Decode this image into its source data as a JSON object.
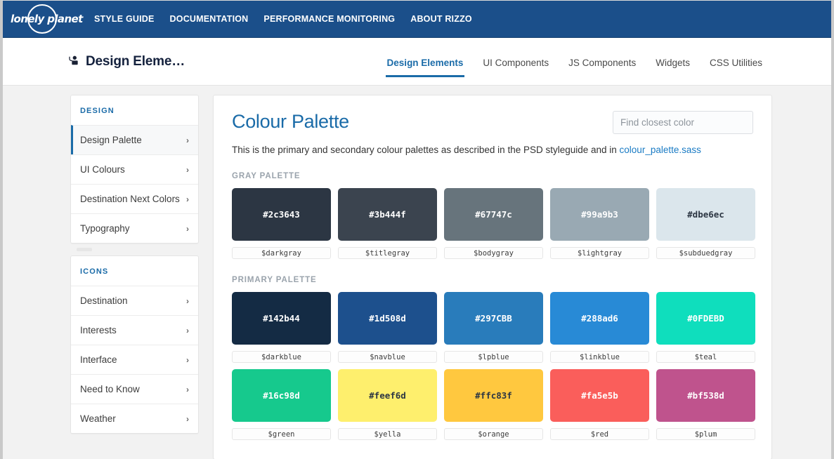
{
  "topnav": {
    "logo_text": "lonely planet",
    "links": [
      {
        "label": "STYLE GUIDE"
      },
      {
        "label": "DOCUMENTATION"
      },
      {
        "label": "PERFORMANCE MONITORING"
      },
      {
        "label": "ABOUT RIZZO"
      }
    ],
    "background": "#1b4f8a"
  },
  "subheader": {
    "title": "Design Eleme…",
    "title_icon": "design-palette-icon",
    "tabs": [
      {
        "label": "Design Elements",
        "active": true
      },
      {
        "label": "UI Components",
        "active": false
      },
      {
        "label": "JS Components",
        "active": false
      },
      {
        "label": "Widgets",
        "active": false
      },
      {
        "label": "CSS Utilities",
        "active": false
      }
    ],
    "accent": "#1a6ba8"
  },
  "sidebar": {
    "groups": [
      {
        "heading": "DESIGN",
        "items": [
          {
            "label": "Design Palette",
            "active": true
          },
          {
            "label": "UI Colours",
            "active": false
          },
          {
            "label": "Destination Next Colors",
            "active": false
          },
          {
            "label": "Typography",
            "active": false
          }
        ]
      },
      {
        "heading": "ICONS",
        "items": [
          {
            "label": "Destination",
            "active": false
          },
          {
            "label": "Interests",
            "active": false
          },
          {
            "label": "Interface",
            "active": false
          },
          {
            "label": "Need to Know",
            "active": false
          },
          {
            "label": "Weather",
            "active": false
          }
        ]
      }
    ],
    "chevron": "›"
  },
  "main": {
    "title": "Colour Palette",
    "search_placeholder": "Find closest color",
    "search_value": "",
    "description_prefix": "This is the primary and secondary colour palettes as described in the PSD styleguide and in ",
    "description_link": "colour_palette.sass",
    "sections": [
      {
        "heading": "GRAY PALETTE",
        "rows": [
          [
            {
              "hex": "#2c3643",
              "name": "$darkgray",
              "text_color": "#ffffff"
            },
            {
              "hex": "#3b444f",
              "name": "$titlegray",
              "text_color": "#ffffff"
            },
            {
              "hex": "#67747c",
              "name": "$bodygray",
              "text_color": "#ffffff"
            },
            {
              "hex": "#99a9b3",
              "name": "$lightgray",
              "text_color": "#ffffff"
            },
            {
              "hex": "#dbe6ec",
              "name": "$subduedgray",
              "text_color": "#2c3643"
            }
          ]
        ]
      },
      {
        "heading": "PRIMARY PALETTE",
        "rows": [
          [
            {
              "hex": "#142b44",
              "name": "$darkblue",
              "text_color": "#ffffff"
            },
            {
              "hex": "#1d508d",
              "name": "$navblue",
              "text_color": "#ffffff"
            },
            {
              "hex": "#297CBB",
              "name": "$lpblue",
              "text_color": "#ffffff"
            },
            {
              "hex": "#288ad6",
              "name": "$linkblue",
              "text_color": "#ffffff"
            },
            {
              "hex": "#0FDEBD",
              "name": "$teal",
              "text_color": "#ffffff"
            }
          ],
          [
            {
              "hex": "#16c98d",
              "name": "$green",
              "text_color": "#ffffff"
            },
            {
              "hex": "#feef6d",
              "name": "$yella",
              "text_color": "#2c3643"
            },
            {
              "hex": "#ffc83f",
              "name": "$orange",
              "text_color": "#2c3643"
            },
            {
              "hex": "#fa5e5b",
              "name": "$red",
              "text_color": "#ffffff"
            },
            {
              "hex": "#bf538d",
              "name": "$plum",
              "text_color": "#ffffff"
            }
          ]
        ]
      }
    ]
  }
}
